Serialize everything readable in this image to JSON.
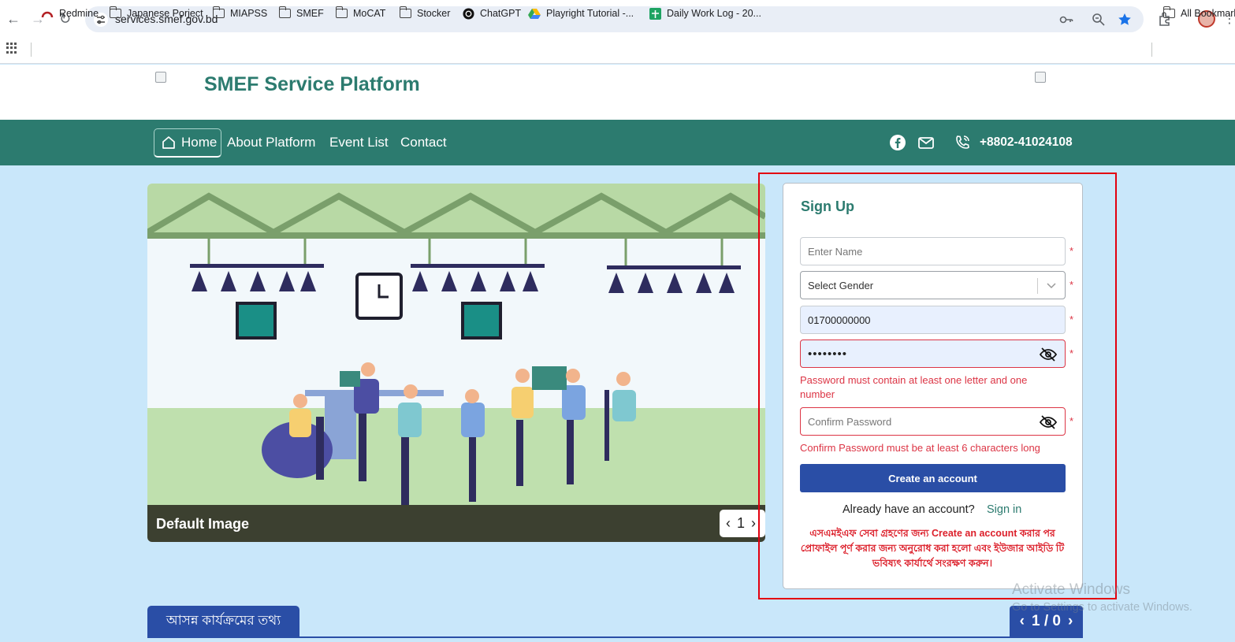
{
  "browser": {
    "url": "services.smef.gov.bd",
    "bookmarks": [
      {
        "label": "Redmine",
        "icon": "redmine-icon"
      },
      {
        "label": "Japanese Porject",
        "icon": "folder-icon"
      },
      {
        "label": "MIAPSS",
        "icon": "folder-icon"
      },
      {
        "label": "SMEF",
        "icon": "folder-icon"
      },
      {
        "label": "MoCAT",
        "icon": "folder-icon"
      },
      {
        "label": "Stocker",
        "icon": "folder-icon"
      },
      {
        "label": "ChatGPT",
        "icon": "chatgpt-icon"
      },
      {
        "label": "Playright Tutorial -...",
        "icon": "drive-icon"
      },
      {
        "label": "Daily Work Log - 20...",
        "icon": "sheets-icon"
      }
    ],
    "all_bookmarks": "All Bookmarks"
  },
  "site": {
    "title": "SMEF Service Platform",
    "nav": {
      "home": "Home",
      "about": "About Platform",
      "events": "Event List",
      "contact": "Contact"
    },
    "phone": "+8802-41024108"
  },
  "carousel": {
    "caption": "Default Image",
    "page": "1"
  },
  "signup": {
    "title": "Sign Up",
    "name_placeholder": "Enter Name",
    "gender_placeholder": "Select Gender",
    "phone_value": "01700000000",
    "password_value": "••••••••",
    "password_error": "Password must contain at least one letter and one number",
    "confirm_placeholder": "Confirm Password",
    "confirm_error": "Confirm Password must be at least 6 characters long",
    "required_mark": "*",
    "create_button": "Create an account",
    "already_text": "Already have an account?",
    "signin_link": "Sign in",
    "bn_note": "এসএমইএফ সেবা গ্রহণের জন্য Create an account করার পর প্রোফাইল পূর্ণ করার জন্য অনুরোধ করা হলো এবং ইউজার আইডি টি ভবিষ্যৎ কার্যার্থে সংরক্ষণ করুন।"
  },
  "bottom": {
    "upcoming_tab": "আসন্ন কার্যক্রমের তথ্য",
    "pager_text": "1 / 0"
  },
  "watermark": {
    "line1": "Activate Windows",
    "line2": "Go to Settings to activate Windows."
  },
  "colors": {
    "brand_green": "#2c7b6f",
    "primary_blue": "#2a4ea6",
    "error_red": "#dc3545",
    "page_bg": "#c9e7fa"
  }
}
